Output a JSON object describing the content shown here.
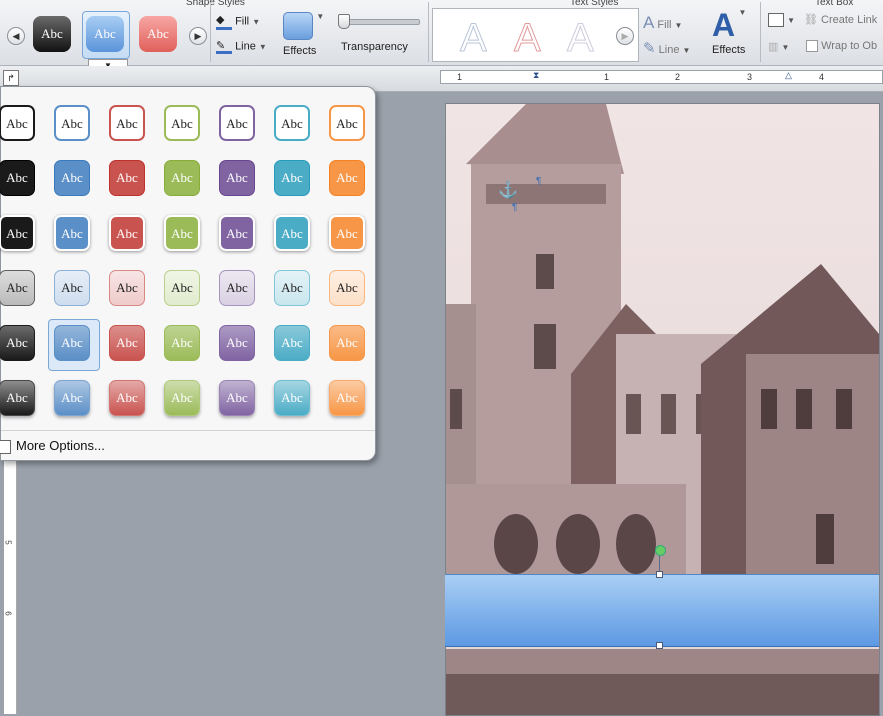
{
  "ribbon": {
    "groups": {
      "shape_styles": "Shape Styles",
      "text_styles": "Text Styles",
      "text_box": "Text Box"
    },
    "fill_label": "Fill",
    "line_label": "Line",
    "effects_label": "Effects",
    "transparency_label": "Transparency",
    "text_fill_label": "Fill",
    "text_line_label": "Line",
    "text_effects_label": "Effects",
    "create_link_label": "Create Link",
    "wrap_label": "Wrap to Ob",
    "swatch_text": "Abc",
    "wordart_glyph": "A"
  },
  "ruler": {
    "numbers": [
      "1",
      "1",
      "2",
      "3",
      "4"
    ]
  },
  "vruler": {
    "numbers": [
      "5",
      "6"
    ]
  },
  "dropdown": {
    "swatch_text": "Abc",
    "more_options_label": "More Options..."
  },
  "colors": {
    "black": "#1a1a1a",
    "blue": "#5b8fc7",
    "red": "#c9534f",
    "green": "#9bbb59",
    "purple": "#8064a2",
    "teal": "#4bacc6",
    "orange": "#f79646",
    "selection": "#7aa7d6"
  },
  "document": {
    "anchor_icon": "⚓",
    "para_mark": "¶"
  }
}
